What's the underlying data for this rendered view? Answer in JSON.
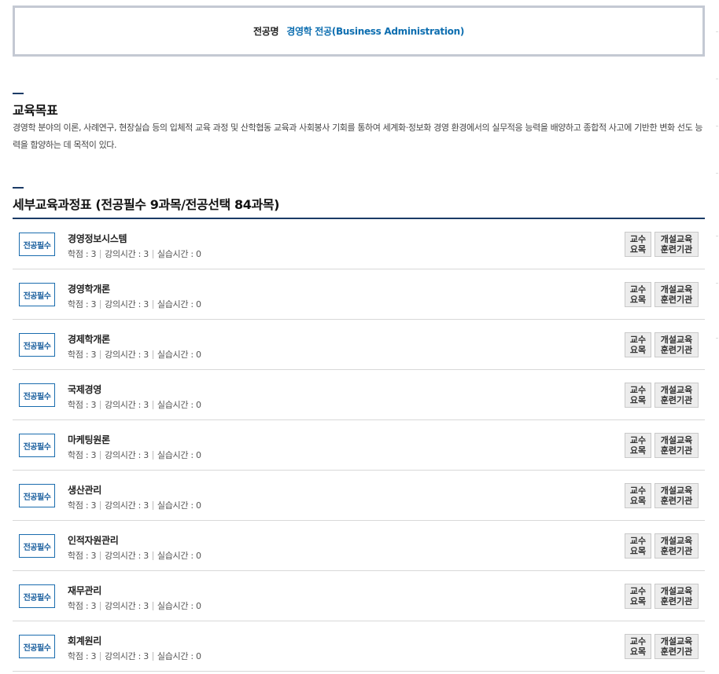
{
  "major": {
    "label": "전공명",
    "value": "경영학 전공(Business Administration)"
  },
  "goal": {
    "title": "교육목표",
    "text": "경영학 분야의 이론, 사례연구, 현장실습 등의 입체적 교육 과정 및 산학협동 교육과 사회봉사 기회를 통하여 세계화·정보화 경영 환경에서의 실무적응 능력을 배양하고 종합적 사고에 기반한 변화 선도 능력을 함양하는 데 목적이 있다."
  },
  "curriculum": {
    "title": "세부교육과정표 (전공필수 9과목/전공선택 84과목)",
    "courses": [
      {
        "type": "전공필수",
        "name": "경영정보시스템",
        "credit": "학점 : 3",
        "lecture": "강의시간 : 3",
        "practice": "실습시간 : 0",
        "btn_prof": "교수\n요목",
        "btn_open": "개설교육\n훈련기관"
      },
      {
        "type": "전공필수",
        "name": "경영학개론",
        "credit": "학점 : 3",
        "lecture": "강의시간 : 3",
        "practice": "실습시간 : 0",
        "btn_prof": "교수\n요목",
        "btn_open": "개설교육\n훈련기관"
      },
      {
        "type": "전공필수",
        "name": "경제학개론",
        "credit": "학점 : 3",
        "lecture": "강의시간 : 3",
        "practice": "실습시간 : 0",
        "btn_prof": "교수\n요목",
        "btn_open": "개설교육\n훈련기관"
      },
      {
        "type": "전공필수",
        "name": "국제경영",
        "credit": "학점 : 3",
        "lecture": "강의시간 : 3",
        "practice": "실습시간 : 0",
        "btn_prof": "교수\n요목",
        "btn_open": "개설교육\n훈련기관"
      },
      {
        "type": "전공필수",
        "name": "마케팅원론",
        "credit": "학점 : 3",
        "lecture": "강의시간 : 3",
        "practice": "실습시간 : 0",
        "btn_prof": "교수\n요목",
        "btn_open": "개설교육\n훈련기관"
      },
      {
        "type": "전공필수",
        "name": "생산관리",
        "credit": "학점 : 3",
        "lecture": "강의시간 : 3",
        "practice": "실습시간 : 0",
        "btn_prof": "교수\n요목",
        "btn_open": "개설교육\n훈련기관"
      },
      {
        "type": "전공필수",
        "name": "인적자원관리",
        "credit": "학점 : 3",
        "lecture": "강의시간 : 3",
        "practice": "실습시간 : 0",
        "btn_prof": "교수\n요목",
        "btn_open": "개설교육\n훈련기관"
      },
      {
        "type": "전공필수",
        "name": "재무관리",
        "credit": "학점 : 3",
        "lecture": "강의시간 : 3",
        "practice": "실습시간 : 0",
        "btn_prof": "교수\n요목",
        "btn_open": "개설교육\n훈련기관"
      },
      {
        "type": "전공필수",
        "name": "회계원리",
        "credit": "학점 : 3",
        "lecture": "강의시간 : 3",
        "practice": "실습시간 : 0",
        "btn_prof": "교수\n요목",
        "btn_open": "개설교육\n훈련기관"
      }
    ]
  }
}
